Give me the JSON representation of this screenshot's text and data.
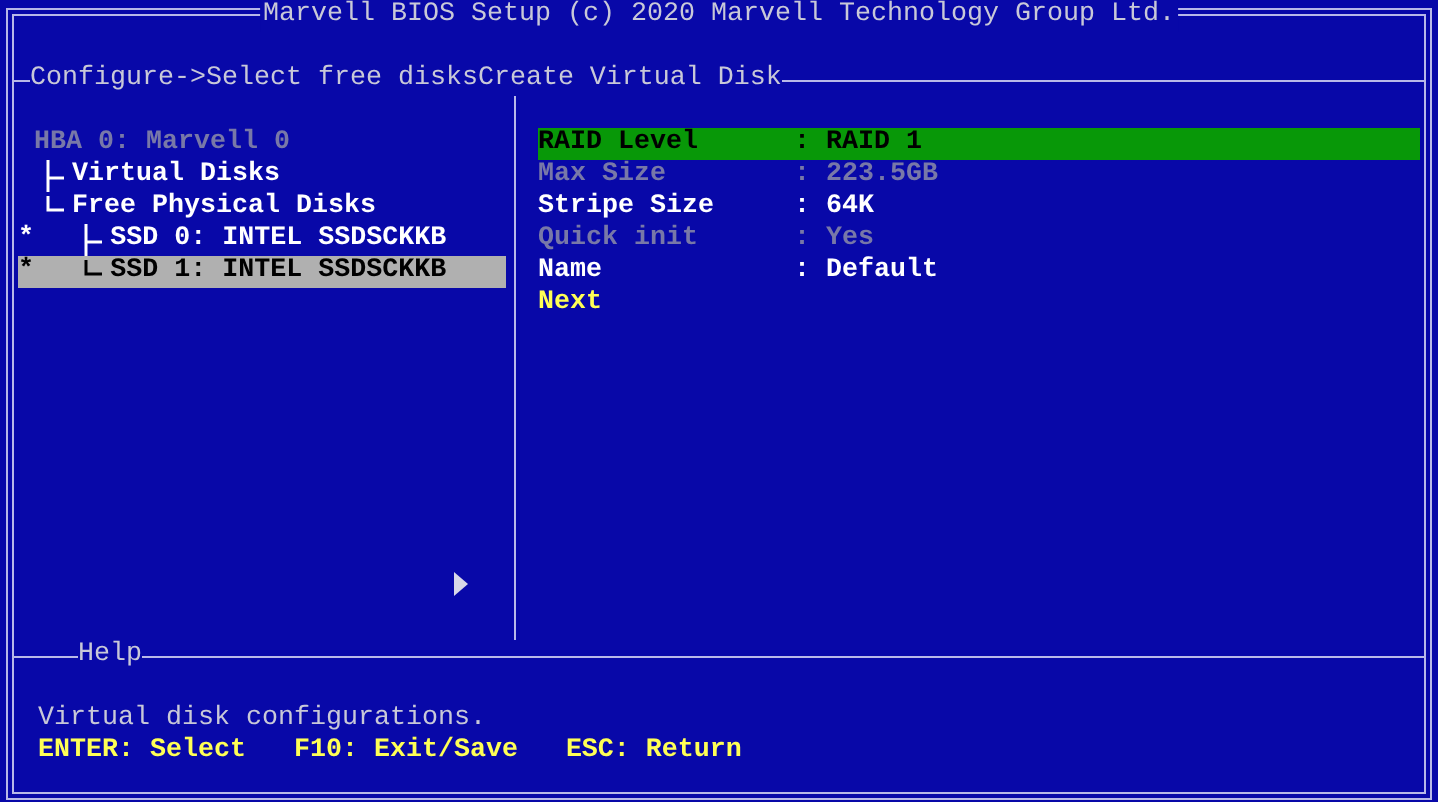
{
  "window": {
    "title": "Marvell BIOS Setup (c) 2020 Marvell Technology Group Ltd."
  },
  "breadcrumb": "Configure->Select free disksCreate Virtual Disk",
  "tree": [
    {
      "label": "HBA 0: Marvell 0",
      "disabled": true,
      "selected": false,
      "children": [
        {
          "label": "Virtual Disks",
          "disabled": false,
          "selected": false
        },
        {
          "label": "Free Physical Disks",
          "disabled": false,
          "selected": false,
          "children": [
            {
              "flag": "*",
              "label": "SSD 0: INTEL SSDSCKKB",
              "disabled": false,
              "selected": false
            },
            {
              "flag": "*",
              "label": "SSD 1: INTEL SSDSCKKB",
              "disabled": false,
              "selected": true
            }
          ]
        }
      ]
    }
  ],
  "settings": [
    {
      "kind": "field",
      "label": "RAID Level",
      "value": ": RAID 1",
      "selected": true,
      "disabled": false
    },
    {
      "kind": "field",
      "label": "Max Size",
      "value": ": 223.5GB",
      "selected": false,
      "disabled": true
    },
    {
      "kind": "field",
      "label": "Stripe Size",
      "value": ": 64K",
      "selected": false,
      "disabled": false
    },
    {
      "kind": "field",
      "label": "Quick init",
      "value": ": Yes",
      "selected": false,
      "disabled": true
    },
    {
      "kind": "field",
      "label": "Name",
      "value": ": Default",
      "selected": false,
      "disabled": false
    },
    {
      "kind": "action",
      "label": "Next",
      "selected": false
    }
  ],
  "help": {
    "title": "Help",
    "text": "Virtual disk configurations.",
    "keys": [
      "ENTER: Select",
      "F10: Exit/Save",
      "ESC: Return"
    ]
  }
}
